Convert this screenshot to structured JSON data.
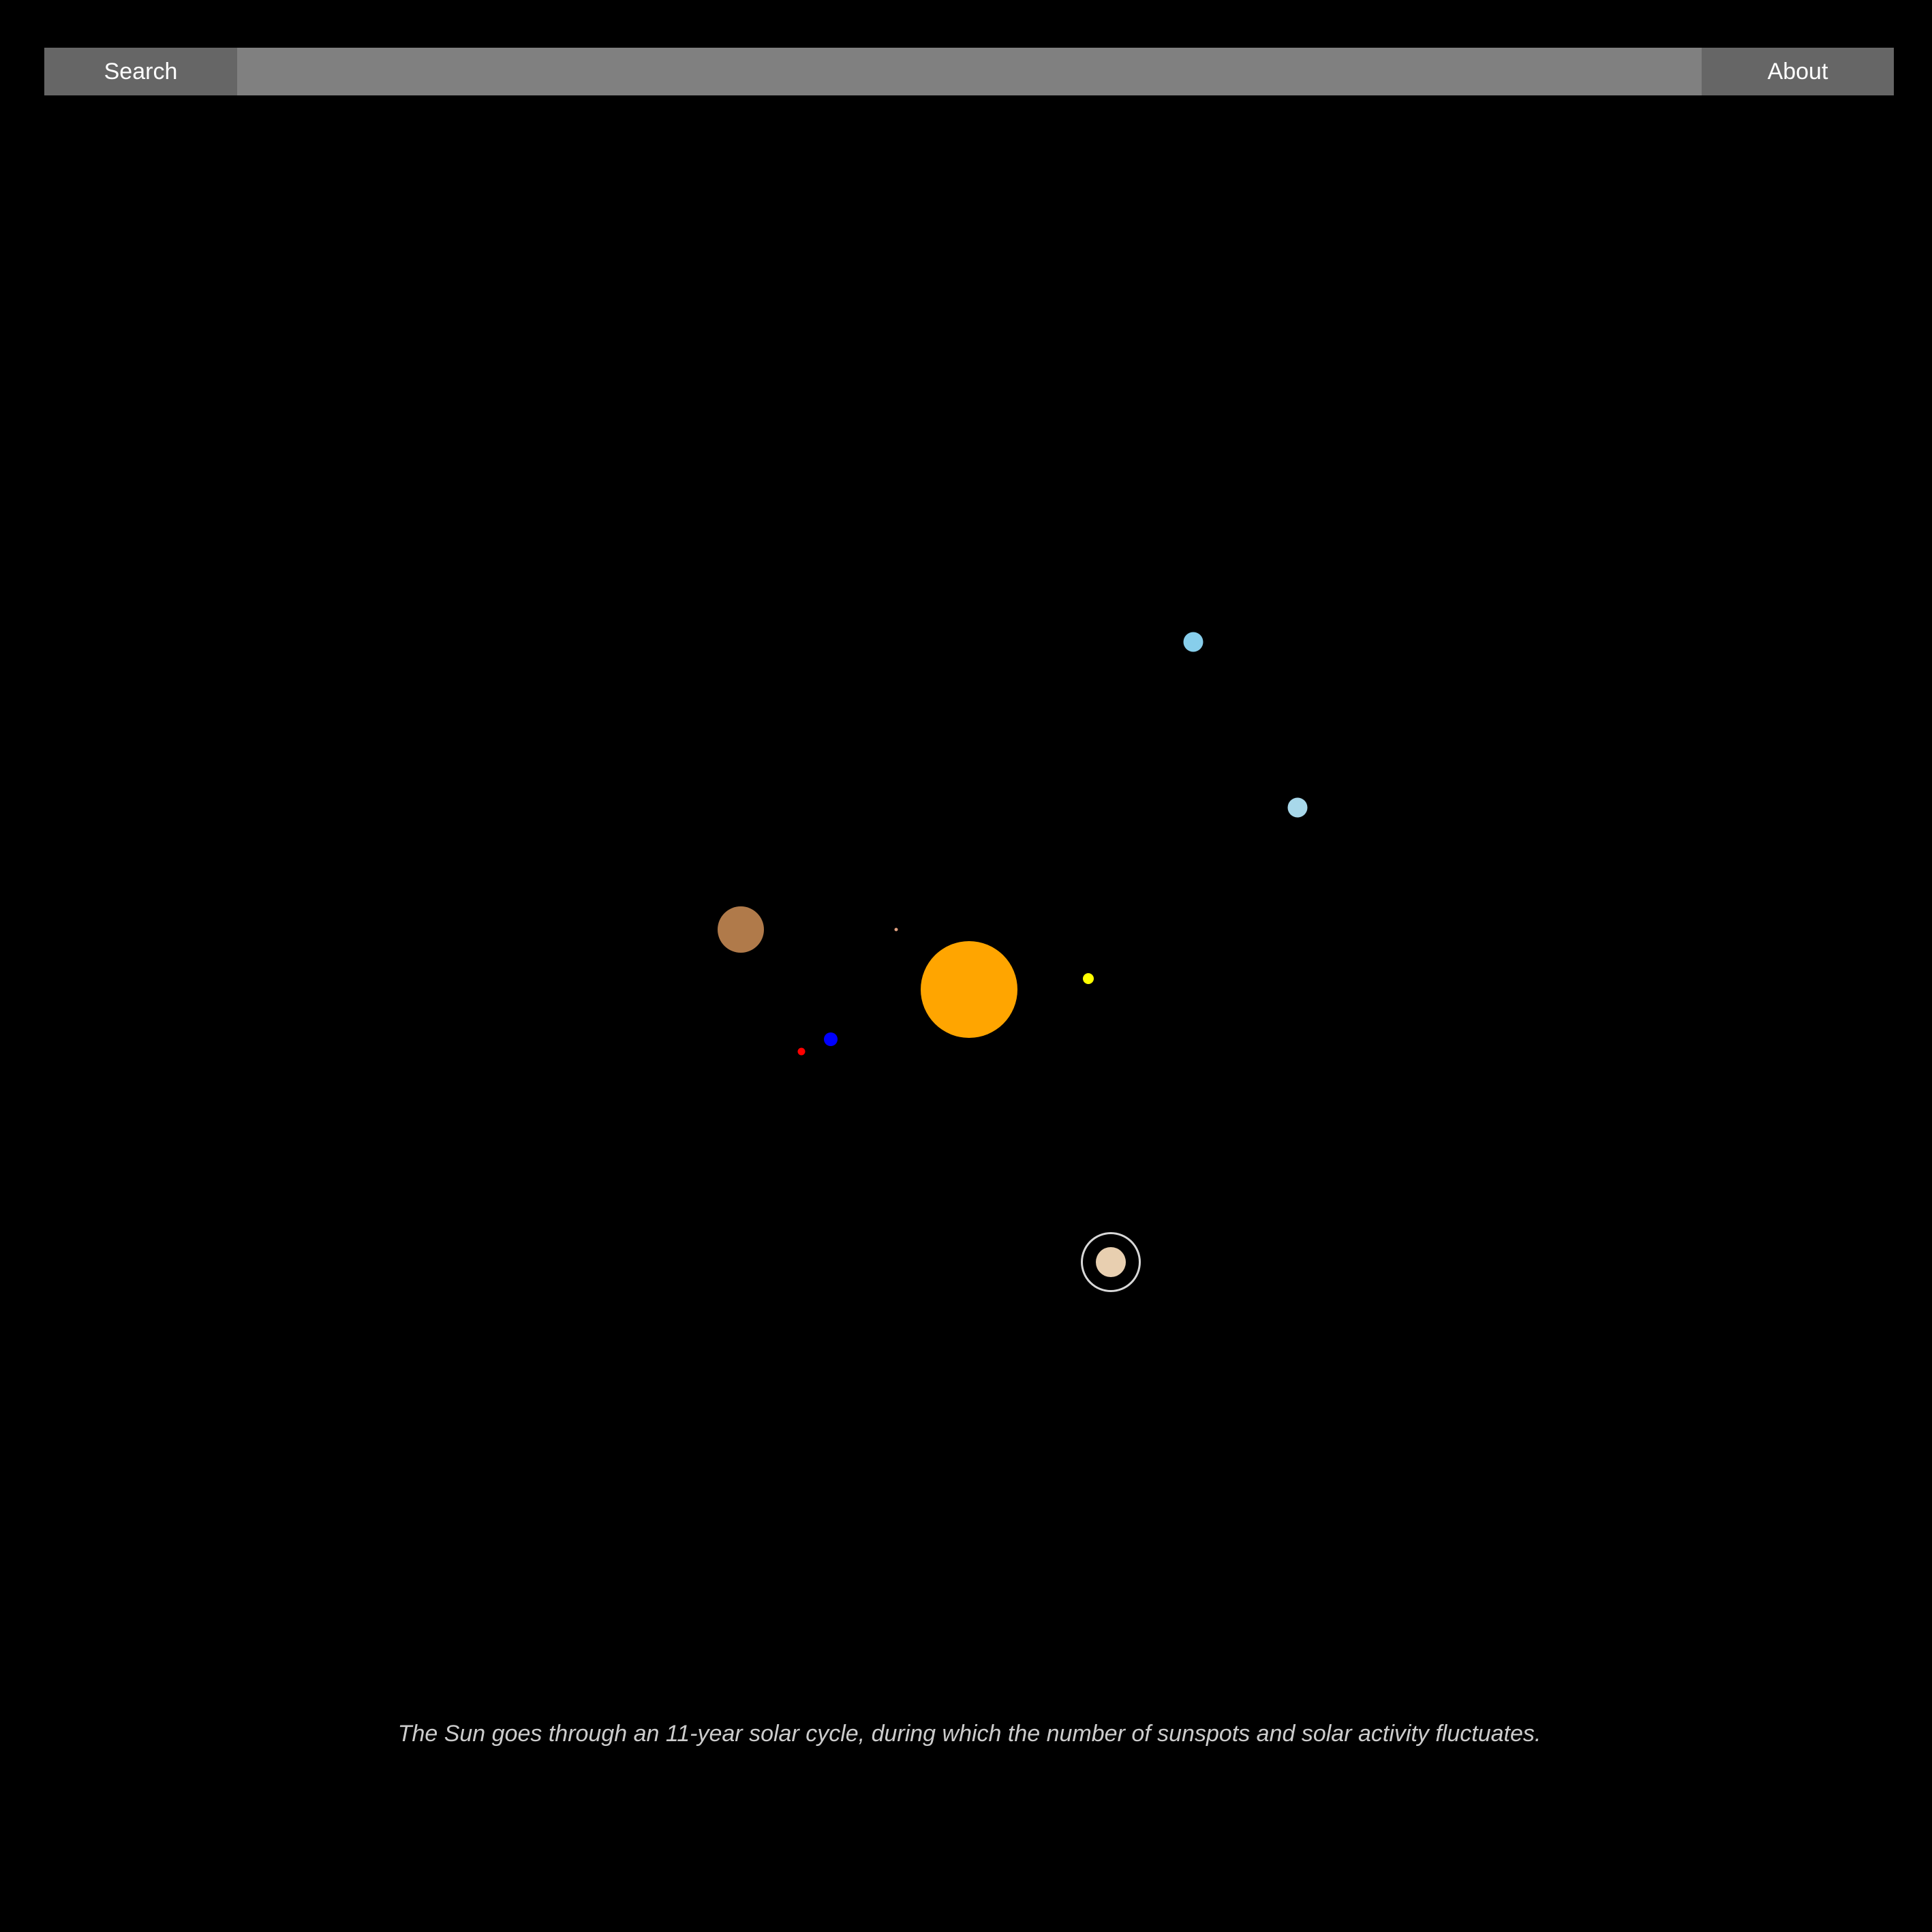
{
  "nav": {
    "search_label": "Search",
    "search_value": "",
    "about_label": "About"
  },
  "bodies": {
    "sun": {
      "color": "#FFA500"
    },
    "mercury": {
      "color": "#E0A080"
    },
    "venus": {
      "color": "#FFFF00"
    },
    "earth": {
      "color": "#0000FF"
    },
    "mars": {
      "color": "#FF0000"
    },
    "jupiter": {
      "color": "#B07A4A"
    },
    "saturn": {
      "color": "#E8CFB0",
      "ring_color": "#D8D8D8"
    },
    "uranus": {
      "color": "#87CEEB"
    },
    "neptune": {
      "color": "#A8D8EA"
    }
  },
  "fact": "The Sun goes through an 11-year solar cycle, during which the number of sunspots and solar activity fluctuates."
}
